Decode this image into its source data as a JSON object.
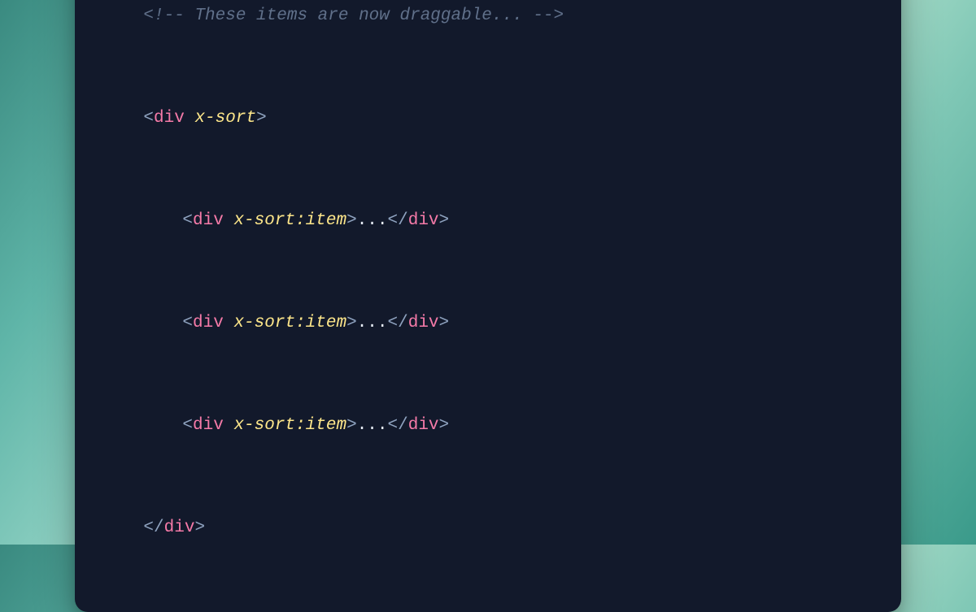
{
  "code": {
    "comment_open": "<!--",
    "comment_text": " These items are now draggable... ",
    "comment_close": "-->",
    "angle_open": "<",
    "angle_close": ">",
    "angle_close_slash": "</",
    "tag_div": "div",
    "attr_xsort": "x-sort",
    "attr_xsort_item": "x-sort:item",
    "dots": "...",
    "space": " "
  }
}
